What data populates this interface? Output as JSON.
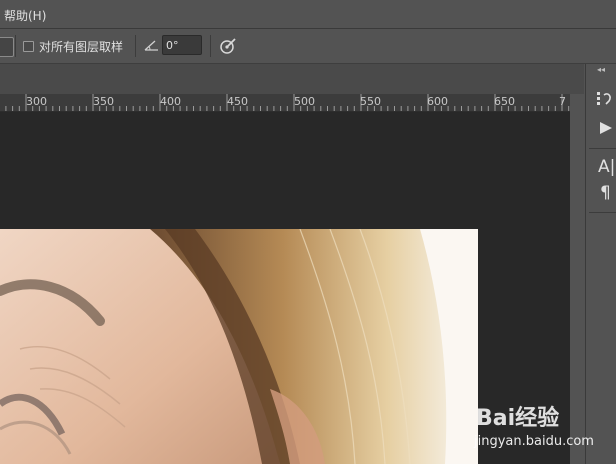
{
  "menubar": {
    "help_label": "帮助(H)"
  },
  "options": {
    "sample_all_layers_label": "对所有图层取样",
    "sample_all_layers_checked": false,
    "angle_value": "0°"
  },
  "ruler": {
    "labels": [
      "300",
      "350",
      "400",
      "450",
      "500",
      "550",
      "600",
      "650",
      "7"
    ]
  },
  "icons": {
    "angle": "angle-icon",
    "brush_settings": "brush-pressure-icon",
    "history": "history-icon",
    "play": "play-icon",
    "character": "character-icon",
    "paragraph": "paragraph-icon"
  },
  "panel": {
    "character_label": "A|",
    "paragraph_label": "¶"
  },
  "watermark": {
    "brand": "Bai经验",
    "url": "jingyan.baidu.com"
  }
}
